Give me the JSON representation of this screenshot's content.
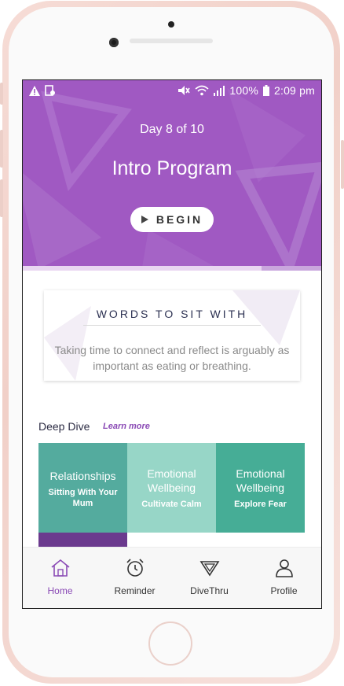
{
  "status_bar": {
    "battery": "100%",
    "time": "2:09 pm"
  },
  "program": {
    "day_label": "Day 8 of 10",
    "title": "Intro Program",
    "begin_label": "BEGIN",
    "progress": 0.8
  },
  "quote_card": {
    "heading": "WORDS TO SIT WITH",
    "text": "Taking time to connect and reflect is arguably as important as eating or breathing."
  },
  "deep_dive": {
    "title": "Deep Dive",
    "link": "Learn more",
    "tiles": [
      {
        "category": "Relationships",
        "subtitle": "Sitting With Your Mum",
        "color": "#54ab9e"
      },
      {
        "category": "Emotional Wellbeing",
        "subtitle": "Cultivate Calm",
        "color": "#97d6c7"
      },
      {
        "category": "Emotional Wellbeing",
        "subtitle": "Explore Fear",
        "color": "#46ad96"
      }
    ]
  },
  "tab_bar": {
    "tabs": [
      {
        "label": "Home",
        "icon": "home-icon",
        "active": true
      },
      {
        "label": "Reminder",
        "icon": "alarm-clock-icon",
        "active": false
      },
      {
        "label": "DiveThru",
        "icon": "divethru-triangle-icon",
        "active": false
      },
      {
        "label": "Profile",
        "icon": "profile-icon",
        "active": false
      }
    ]
  },
  "colors": {
    "hero": "#a059c2",
    "accent": "#8a4ab5",
    "heading": "#2c3152"
  }
}
